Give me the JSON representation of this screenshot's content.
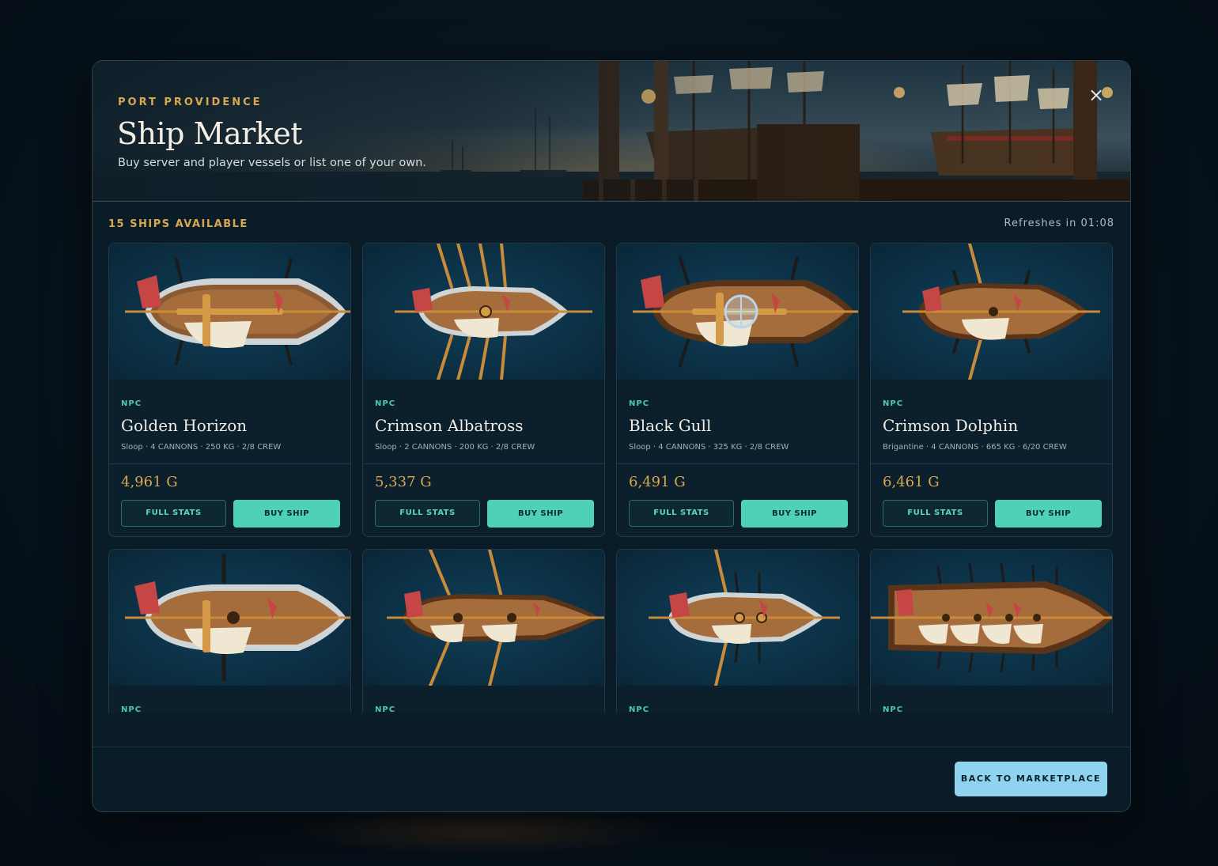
{
  "header": {
    "eyebrow": "PORT PROVIDENCE",
    "title": "Ship Market",
    "subtitle": "Buy server and player vessels or list one of your own.",
    "close_label": "×"
  },
  "market": {
    "count_label": "15 SHIPS AVAILABLE",
    "refresh_label": "Refreshes in 01:08"
  },
  "cards": [
    {
      "owner": "NPC",
      "name": "Golden Horizon",
      "meta": "Sloop · 4 CANNONS · 250 KG · 2/8 CREW",
      "price": "4,961 G",
      "stats_label": "FULL STATS",
      "buy_label": "BUY SHIP"
    },
    {
      "owner": "NPC",
      "name": "Crimson Albatross",
      "meta": "Sloop · 2 CANNONS · 200 KG · 2/8 CREW",
      "price": "5,337 G",
      "stats_label": "FULL STATS",
      "buy_label": "BUY SHIP"
    },
    {
      "owner": "NPC",
      "name": "Black Gull",
      "meta": "Sloop · 4 CANNONS · 325 KG · 2/8 CREW",
      "price": "6,491 G",
      "stats_label": "FULL STATS",
      "buy_label": "BUY SHIP"
    },
    {
      "owner": "NPC",
      "name": "Crimson Dolphin",
      "meta": "Brigantine · 4 CANNONS · 665 KG · 6/20 CREW",
      "price": "6,461 G",
      "stats_label": "FULL STATS",
      "buy_label": "BUY SHIP"
    },
    {
      "owner": "NPC"
    },
    {
      "owner": "NPC"
    },
    {
      "owner": "NPC"
    },
    {
      "owner": "NPC"
    }
  ],
  "footer": {
    "back_label": "BACK TO MARKETPLACE"
  },
  "colors": {
    "accent_gold": "#d9a84e",
    "accent_teal": "#4fd1b8",
    "back_button": "#8fd3ef",
    "panel": "#0a1c28"
  },
  "icons": {
    "close": "close-icon",
    "crosshair": "crosshair-icon"
  }
}
